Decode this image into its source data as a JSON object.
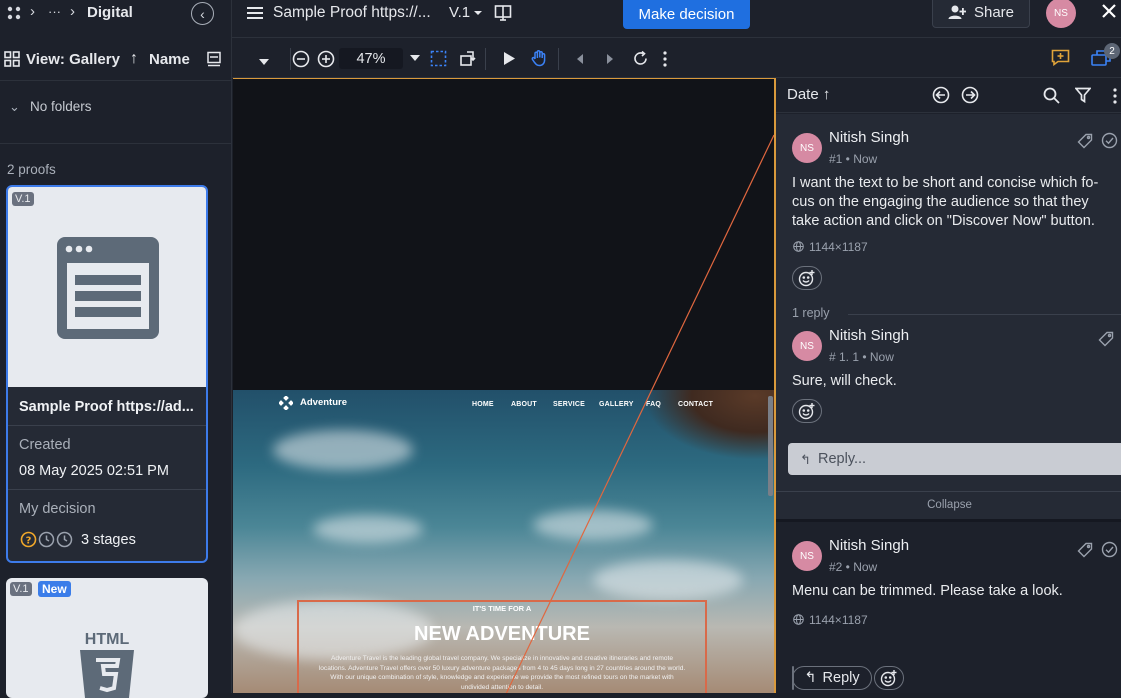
{
  "sidebar": {
    "breadcrumb_ellipsis": "···",
    "breadcrumb_current": "Digital",
    "view_label": "View: Gallery",
    "sort_label": "Name",
    "folders_label": "No folders",
    "proofs_count": "2 proofs",
    "cards": [
      {
        "version": "V.1",
        "title": "Sample Proof https://ad...",
        "created_label": "Created",
        "created_value": "08 May 2025 02:51 PM",
        "decision_label": "My decision",
        "stages": "3 stages"
      },
      {
        "version": "V.1",
        "new_badge": "New",
        "icon_text": "HTML"
      }
    ]
  },
  "topbar": {
    "proof_title": "Sample Proof https://...",
    "version": "V.1",
    "make_decision": "Make decision",
    "share": "Share",
    "avatar": "NS"
  },
  "toolbar": {
    "zoom": "47%",
    "comment_count": "2"
  },
  "preview": {
    "brand": "Adventure",
    "nav": [
      "HOME",
      "ABOUT",
      "SERVICE",
      "GALLERY",
      "FAQ",
      "CONTACT"
    ],
    "kicker": "IT'S TIME FOR A",
    "headline": "NEW ADVENTURE",
    "body": "Adventure Travel is the leading global travel company. We specialize in innovative and creative itineraries and remote locations. Adventure Travel offers over 50 luxury adventure packages from 4 to 45 days long in 27 countries around the world. With our unique combination of style, knowledge and experience we provide the most refined tours on the market with undivided attention to detail."
  },
  "panel": {
    "sort_label": "Date",
    "comments": [
      {
        "avatar": "NS",
        "name": "Nitish Singh",
        "meta": "#1 • Now",
        "text": "I want the text to be short and concise which fo-cus on the engaging the audience so that they take action and click on \"Discover Now\" button.",
        "dims": "1144×1187",
        "reply_count": "1 reply",
        "reply": {
          "avatar": "NS",
          "name": "Nitish Singh",
          "meta": "# 1. 1 • Now",
          "text": "Sure, will check."
        },
        "reply_placeholder": "Reply...",
        "collapse": "Collapse"
      },
      {
        "avatar": "NS",
        "name": "Nitish Singh",
        "meta": "#2 • Now",
        "text": "Menu can be trimmed. Please take a look.",
        "dims": "1144×1187",
        "reply_button": "Reply"
      }
    ]
  },
  "colors": {
    "accent": "#1f6fe0",
    "avatar": "#d68aa3",
    "highlight": "#d99a3c",
    "annotation": "#e0673f"
  }
}
